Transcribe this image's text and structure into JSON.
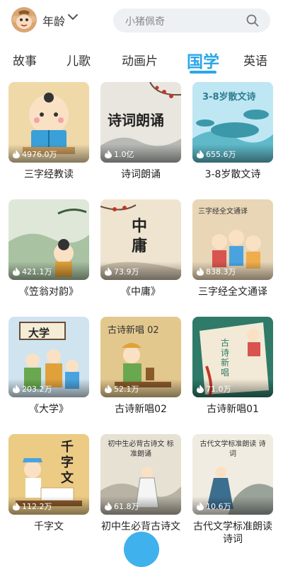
{
  "header": {
    "age_label": "年龄",
    "search_placeholder": "小猪佩奇"
  },
  "tabs": [
    {
      "label": "故事",
      "active": false
    },
    {
      "label": "儿歌",
      "active": false
    },
    {
      "label": "动画片",
      "active": false
    },
    {
      "label": "国学",
      "active": true
    },
    {
      "label": "英语",
      "active": false
    }
  ],
  "items": [
    {
      "title": "三字经教读",
      "plays": "4976.0万",
      "art_text": ""
    },
    {
      "title": "诗词朗诵",
      "plays": "1.0亿",
      "art_text": "诗词朗诵"
    },
    {
      "title": "3-8岁散文诗",
      "plays": "655.6万",
      "art_text": "3-8岁散文诗"
    },
    {
      "title": "《笠翁对韵》",
      "plays": "421.1万",
      "art_text": ""
    },
    {
      "title": "《中庸》",
      "plays": "73.9万",
      "art_text": "中庸"
    },
    {
      "title": "三字经全文通译",
      "plays": "838.3万",
      "art_text": "三字经全文通译"
    },
    {
      "title": "《大学》",
      "plays": "203.2万",
      "art_text": "大学"
    },
    {
      "title": "古诗新唱02",
      "plays": "52.1万",
      "art_text": "古诗新唱 02"
    },
    {
      "title": "古诗新唱01",
      "plays": "71.0万",
      "art_text": "古诗新唱"
    },
    {
      "title": "千字文",
      "plays": "112.2万",
      "art_text": "千字文"
    },
    {
      "title": "初中生必背古诗文言",
      "plays": "61.8万",
      "art_text": "初中生必背古诗文 标准朗诵"
    },
    {
      "title": "古代文学标准朗读 诗词",
      "plays": "10.6万",
      "art_text": "古代文学标准朗读 诗词"
    }
  ],
  "colors": {
    "accent": "#2aa6e8",
    "search_bg": "#eef1f4"
  }
}
